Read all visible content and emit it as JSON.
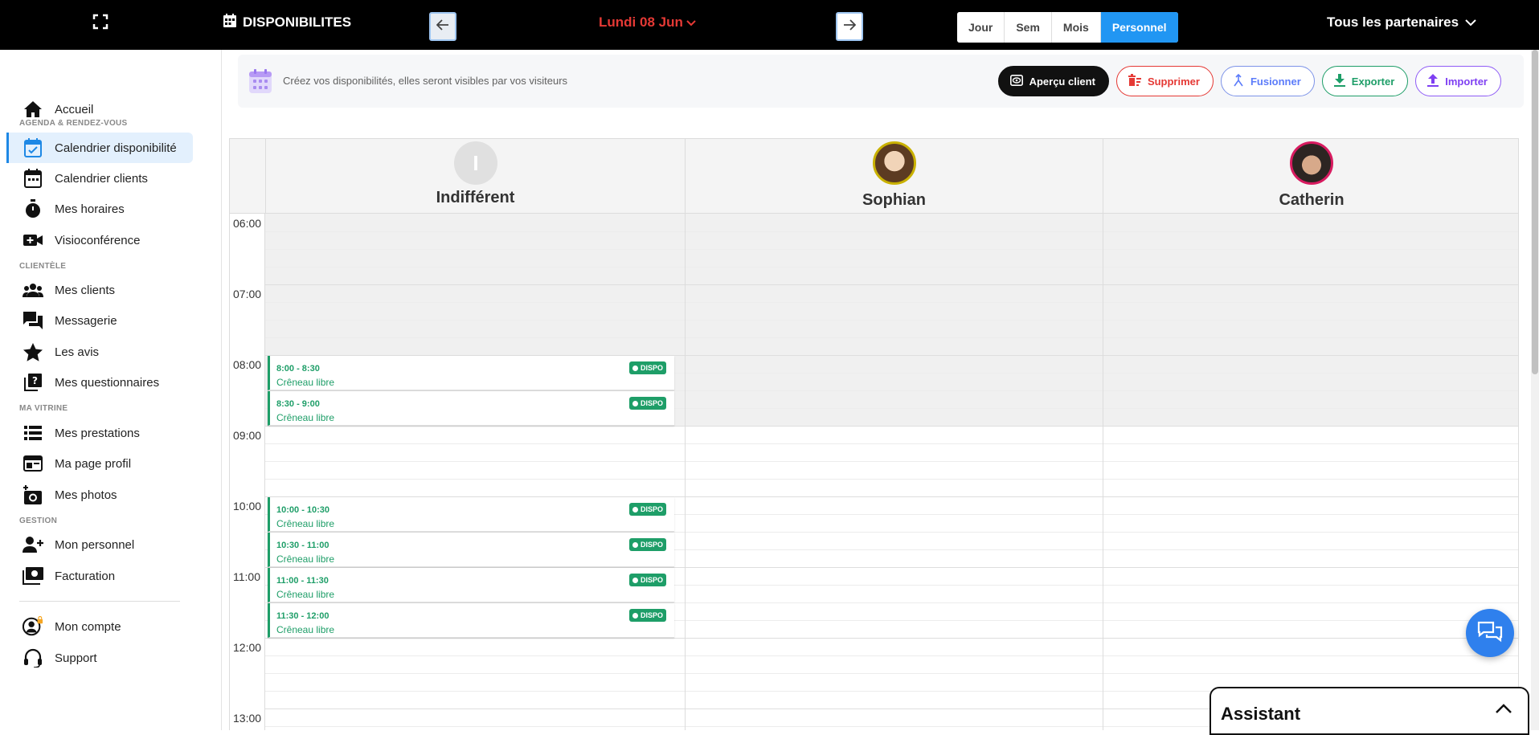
{
  "topbar": {
    "title": "DISPONIBILITES",
    "date": "Lundi 08 Jun",
    "views": [
      "Jour",
      "Sem",
      "Mois",
      "Personnel"
    ],
    "active_view": "Personnel",
    "partners": "Tous les partenaires"
  },
  "sidebar": {
    "items": [
      {
        "label": "Accueil",
        "icon": "home-icon"
      },
      {
        "label": "Calendrier disponibilité",
        "icon": "calendar-check-icon",
        "active": true
      },
      {
        "label": "Calendrier clients",
        "icon": "calendar-icon"
      },
      {
        "label": "Mes horaires",
        "icon": "stopwatch-icon"
      },
      {
        "label": "Visioconférence",
        "icon": "video-plus-icon"
      },
      {
        "label": "Mes clients",
        "icon": "people-icon"
      },
      {
        "label": "Messagerie",
        "icon": "chat-bubbles-icon"
      },
      {
        "label": "Les avis",
        "icon": "star-icon"
      },
      {
        "label": "Mes questionnaires",
        "icon": "question-box-icon"
      },
      {
        "label": "Mes prestations",
        "icon": "list-icon"
      },
      {
        "label": "Ma page profil",
        "icon": "web-page-icon"
      },
      {
        "label": "Mes photos",
        "icon": "camera-plus-icon"
      },
      {
        "label": "Mon personnel",
        "icon": "person-add-icon"
      },
      {
        "label": "Facturation",
        "icon": "money-icon"
      },
      {
        "label": "Mon compte",
        "icon": "account-circle-icon"
      },
      {
        "label": "Support",
        "icon": "headset-icon"
      }
    ],
    "sections": {
      "agenda": "AGENDA & RENDEZ-VOUS",
      "clientele": "CLIENTÈLE",
      "vitrine": "MA VITRINE",
      "gestion": "GESTION"
    }
  },
  "infobar": {
    "text": "Créez vos disponibilités, elles seront visibles par vos visiteurs",
    "buttons": {
      "preview": "Aperçu client",
      "delete": "Supprimer",
      "merge": "Fusionner",
      "export": "Exporter",
      "import": "Importer"
    }
  },
  "calendar": {
    "columns": [
      {
        "name": "Indifférent",
        "initial": "I"
      },
      {
        "name": "Sophian"
      },
      {
        "name": "Catherin"
      }
    ],
    "hours": [
      "06:00",
      "07:00",
      "08:00",
      "09:00",
      "10:00",
      "11:00",
      "12:00",
      "13:00"
    ],
    "slots": [
      {
        "time": "8:00 - 8:30",
        "label": "Crêneau libre",
        "badge": "DISPO"
      },
      {
        "time": "8:30 - 9:00",
        "label": "Crêneau libre",
        "badge": "DISPO"
      },
      {
        "time": "10:00 - 10:30",
        "label": "Crêneau libre",
        "badge": "DISPO"
      },
      {
        "time": "10:30 - 11:00",
        "label": "Crêneau libre",
        "badge": "DISPO"
      },
      {
        "time": "11:00 - 11:30",
        "label": "Crêneau libre",
        "badge": "DISPO"
      },
      {
        "time": "11:30 - 12:00",
        "label": "Crêneau libre",
        "badge": "DISPO"
      }
    ]
  },
  "assistant": {
    "title": "Assistant"
  },
  "colors": {
    "accent": "#2196f3",
    "dispo": "#1e9e68",
    "date": "#e53935"
  }
}
